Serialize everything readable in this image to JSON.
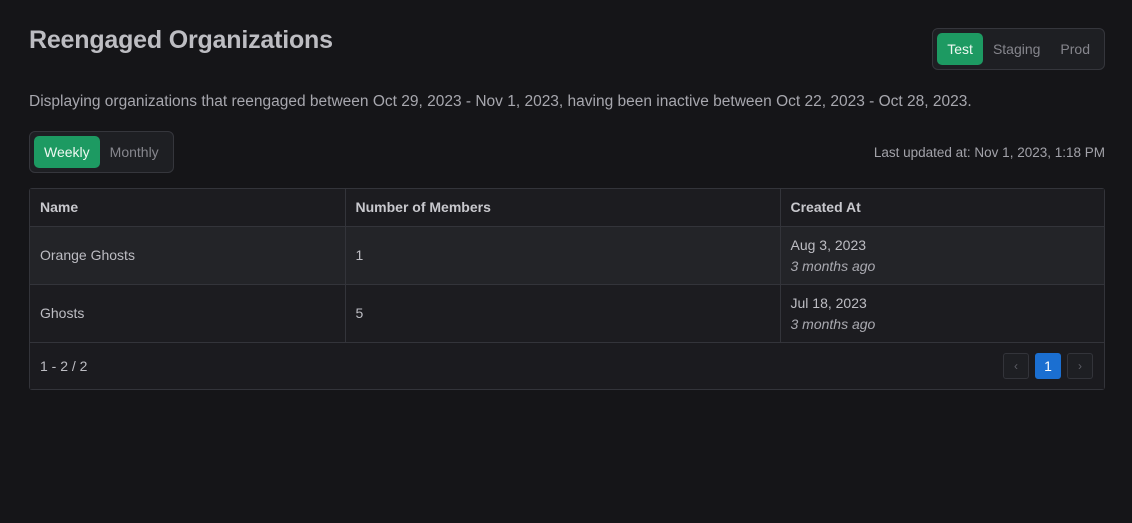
{
  "header": {
    "title": "Reengaged Organizations",
    "environments": [
      "Test",
      "Staging",
      "Prod"
    ],
    "active_environment": "Test"
  },
  "description": "Displaying organizations that reengaged between Oct 29, 2023 - Nov 1, 2023, having been inactive between Oct 22, 2023 - Oct 28, 2023.",
  "period_toggle": {
    "options": [
      "Weekly",
      "Monthly"
    ],
    "active": "Weekly"
  },
  "last_updated": "Last updated at: Nov 1, 2023, 1:18 PM",
  "table": {
    "columns": [
      "Name",
      "Number of Members",
      "Created At"
    ],
    "rows": [
      {
        "name": "Orange Ghosts",
        "members": "1",
        "created_date": "Aug 3, 2023",
        "created_relative": "3 months ago"
      },
      {
        "name": "Ghosts",
        "members": "5",
        "created_date": "Jul 18, 2023",
        "created_relative": "3 months ago"
      }
    ]
  },
  "pagination": {
    "range": "1 - 2 / 2",
    "current_page": "1",
    "prev_icon": "chevron-left-icon",
    "next_icon": "chevron-right-icon"
  },
  "colors": {
    "background": "#151518",
    "accent_green": "#1d9a62",
    "accent_blue": "#1b6fd1"
  }
}
